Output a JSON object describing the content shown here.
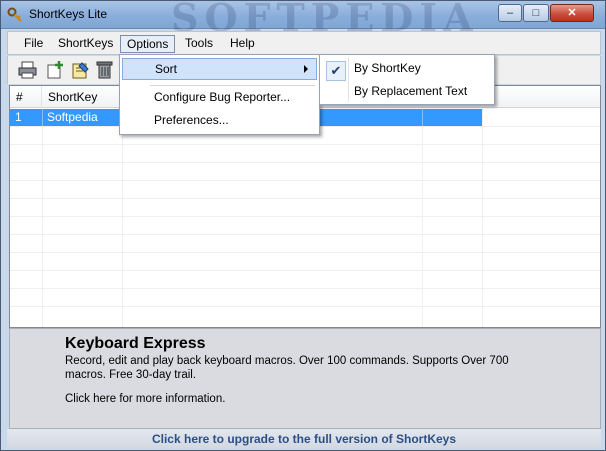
{
  "window": {
    "title": "ShortKeys Lite",
    "watermark": "SOFTPEDIA",
    "minimize_glyph": "–",
    "maximize_glyph": "□",
    "close_glyph": "✕"
  },
  "menubar": {
    "items": [
      {
        "label": "File",
        "accel": "F"
      },
      {
        "label": "ShortKeys",
        "accel": "S"
      },
      {
        "label": "Options",
        "accel": "O"
      },
      {
        "label": "Tools",
        "accel": "T"
      },
      {
        "label": "Help",
        "accel": "H"
      }
    ]
  },
  "toolbar": {
    "icons": [
      "printer-icon",
      "new-shortkey-icon",
      "edit-shortkey-icon",
      "delete-icon"
    ]
  },
  "list": {
    "columns": [
      "#",
      "ShortKey"
    ],
    "rows": [
      {
        "num": "1",
        "shortkey": "Softpedia"
      }
    ],
    "selection_color": "#3399ff"
  },
  "options_menu": {
    "items": [
      {
        "label": "Sort",
        "has_submenu": true
      },
      {
        "label": "Configure Bug Reporter..."
      },
      {
        "label": "Preferences..."
      }
    ]
  },
  "sort_submenu": {
    "items": [
      {
        "label": "By ShortKey",
        "checked": true,
        "check_glyph": "✔"
      },
      {
        "label": "By Replacement Text",
        "checked": false
      }
    ]
  },
  "ad": {
    "title": "Keyboard Express",
    "description": "Record, edit and play back keyboard macros. Over 100 commands. Supports Over 700 macros. Free 30-day trail.",
    "link": "Click here for more information."
  },
  "upgrade_link": "Click here to upgrade to the full version of ShortKeys",
  "colors": {
    "accent": "#3399ff",
    "upgrade_text": "#2c4f86",
    "menu_highlight": "#cfe3fb"
  }
}
